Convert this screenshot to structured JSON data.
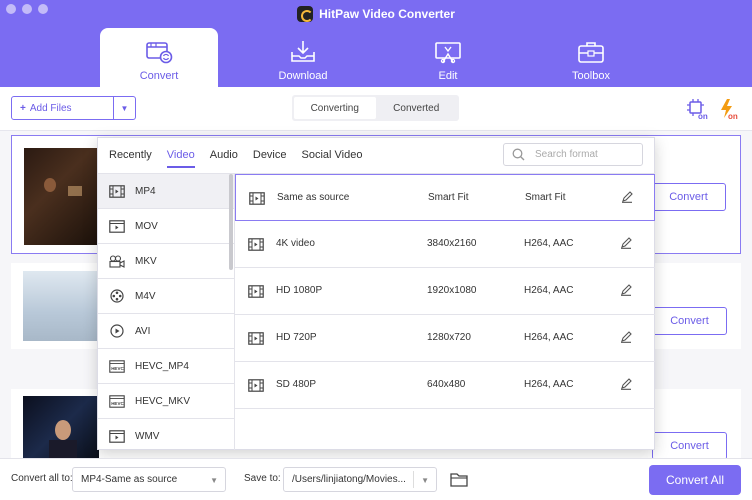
{
  "app": {
    "title": "HitPaw Video Converter"
  },
  "colors": {
    "accent": "#7b6cf2",
    "accent_dark": "#6b5ce7",
    "header_bg": "#7b6cf2",
    "flash": "#f39c12"
  },
  "nav": {
    "items": [
      {
        "label": "Convert",
        "icon": "convert-icon",
        "active": true
      },
      {
        "label": "Download",
        "icon": "download-icon",
        "active": false
      },
      {
        "label": "Edit",
        "icon": "edit-icon",
        "active": false
      },
      {
        "label": "Toolbox",
        "icon": "toolbox-icon",
        "active": false
      }
    ]
  },
  "toolbar": {
    "add_files_label": "Add Files",
    "segments": [
      {
        "label": "Converting",
        "active": true
      },
      {
        "label": "Converted",
        "active": false
      }
    ],
    "hw_accel_icon": "hardware-acceleration-icon",
    "flash_icon": "flash-on-icon"
  },
  "files": [
    {
      "convert_label": "Convert",
      "thumb": "dark-movie-scene"
    },
    {
      "convert_label": "Convert",
      "thumb": "sky-landscape"
    },
    {
      "convert_label": "Convert",
      "thumb": "night-city-person"
    }
  ],
  "format_popup": {
    "tabs": [
      {
        "label": "Recently",
        "active": false
      },
      {
        "label": "Video",
        "active": true
      },
      {
        "label": "Audio",
        "active": false
      },
      {
        "label": "Device",
        "active": false
      },
      {
        "label": "Social Video",
        "active": false
      }
    ],
    "search_placeholder": "Search format",
    "formats": [
      {
        "label": "MP4",
        "icon": "film-icon",
        "selected": true
      },
      {
        "label": "MOV",
        "icon": "film-play-icon",
        "selected": false
      },
      {
        "label": "MKV",
        "icon": "camera-icon",
        "selected": false
      },
      {
        "label": "M4V",
        "icon": "reel-icon",
        "selected": false
      },
      {
        "label": "AVI",
        "icon": "play-circle-icon",
        "selected": false
      },
      {
        "label": "HEVC_MP4",
        "icon": "hevc-icon",
        "selected": false
      },
      {
        "label": "HEVC_MKV",
        "icon": "hevc-icon",
        "selected": false
      },
      {
        "label": "WMV",
        "icon": "film-play-icon",
        "selected": false
      }
    ],
    "resolutions": [
      {
        "name": "Same as source",
        "resolution": "Smart Fit",
        "codec": "Smart Fit",
        "selected": true
      },
      {
        "name": "4K video",
        "resolution": "3840x2160",
        "codec": "H264, AAC",
        "selected": false
      },
      {
        "name": "HD 1080P",
        "resolution": "1920x1080",
        "codec": "H264, AAC",
        "selected": false
      },
      {
        "name": "HD 720P",
        "resolution": "1280x720",
        "codec": "H264, AAC",
        "selected": false
      },
      {
        "name": "SD 480P",
        "resolution": "640x480",
        "codec": "H264, AAC",
        "selected": false
      }
    ]
  },
  "bottom": {
    "convert_all_to_label": "Convert all to:",
    "convert_all_to_value": "MP4-Same as source",
    "save_to_label": "Save to:",
    "save_to_value": "/Users/linjiatong/Movies...",
    "convert_all_button": "Convert All"
  }
}
